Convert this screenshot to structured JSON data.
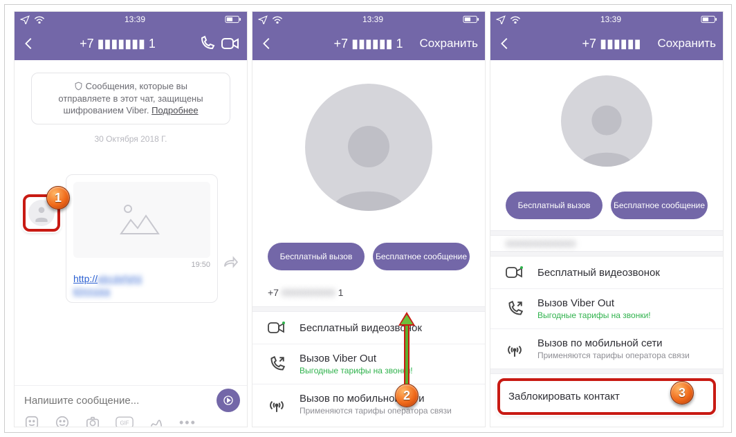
{
  "status": {
    "time": "13:39"
  },
  "screen1": {
    "title": "+7 ▮▮▮▮▮▮▮ 1",
    "sys_line1": "Сообщения, которые вы",
    "sys_line2": "отправляете в этот чат, защищены",
    "sys_line3": "шифрованием Viber.",
    "sys_more": "Подробнее",
    "date": "30 Октября 2018 Г.",
    "msg_time": "19:50",
    "msg_link_prefix": "http://",
    "composer_placeholder": "Напишите сообщение..."
  },
  "screen2": {
    "title": "+7 ▮▮▮▮▮▮ 1",
    "save": "Сохранить",
    "btn_call": "Бесплатный вызов",
    "btn_msg": "Бесплатное сообщение",
    "phone_prefix": "+7",
    "phone_suffix": "1",
    "rows": {
      "video": "Бесплатный видеозвонок",
      "viberout": "Вызов Viber Out",
      "viberout_sub": "Выгодные тарифы на звонки!",
      "cell": "Вызов по мобильной сети",
      "cell_sub": "Применяются тарифы оператора связи"
    }
  },
  "screen3": {
    "title": "+7 ▮▮▮▮▮▮",
    "save": "Сохранить",
    "btn_call": "Бесплатный вызов",
    "btn_msg": "Бесплатное сообщение",
    "rows": {
      "video": "Бесплатный видеозвонок",
      "viberout": "Вызов Viber Out",
      "viberout_sub": "Выгодные тарифы на звонки!",
      "cell": "Вызов по мобильной сети",
      "cell_sub": "Применяются тарифы оператора связи",
      "block": "Заблокировать контакт"
    }
  },
  "badges": {
    "b1": "1",
    "b2": "2",
    "b3": "3"
  }
}
